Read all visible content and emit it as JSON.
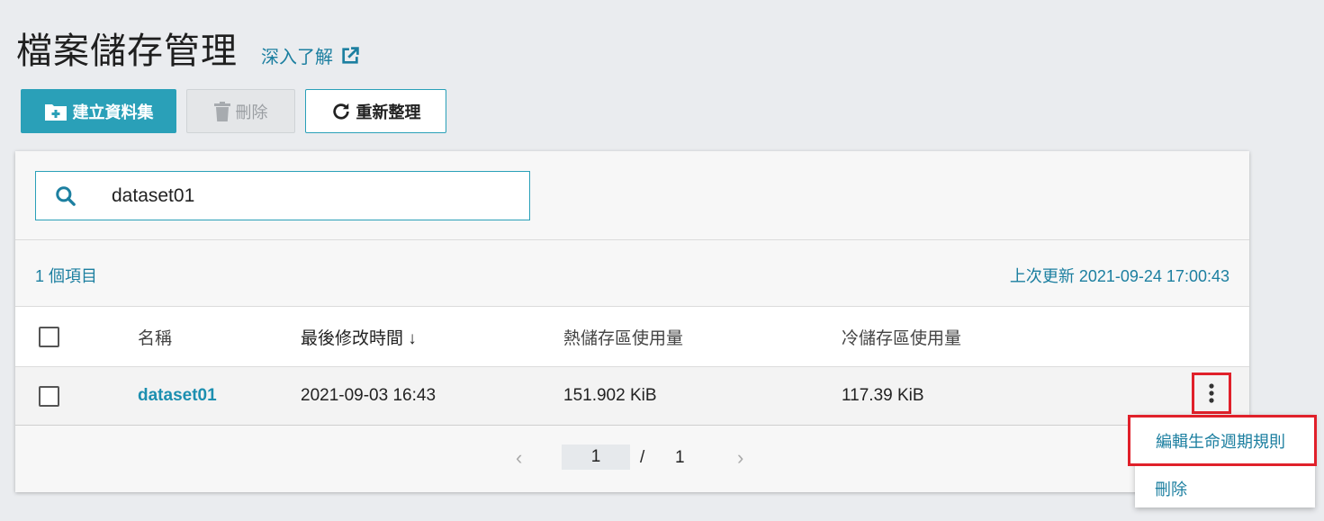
{
  "header": {
    "title": "檔案儲存管理",
    "learn_more": "深入了解"
  },
  "toolbar": {
    "create_label": "建立資料集",
    "delete_label": "刪除",
    "refresh_label": "重新整理"
  },
  "search": {
    "value": "dataset01"
  },
  "info": {
    "item_count": "1 個項目",
    "last_update": "上次更新 2021-09-24 17:00:43"
  },
  "table": {
    "columns": {
      "name": "名稱",
      "modified": "最後修改時間 ↓",
      "hot": "熱儲存區使用量",
      "cold": "冷儲存區使用量"
    },
    "rows": [
      {
        "name": "dataset01",
        "modified": "2021-09-03 16:43",
        "hot": "151.902 KiB",
        "cold": "117.39 KiB"
      }
    ]
  },
  "pager": {
    "current": "1",
    "separator": "/",
    "total": "1"
  },
  "menu": {
    "edit_lifecycle": "編輯生命週期規則",
    "delete": "刪除"
  },
  "colors": {
    "accent": "#2aa0b8",
    "link": "#1c7fa0",
    "highlight": "#e0202a"
  }
}
